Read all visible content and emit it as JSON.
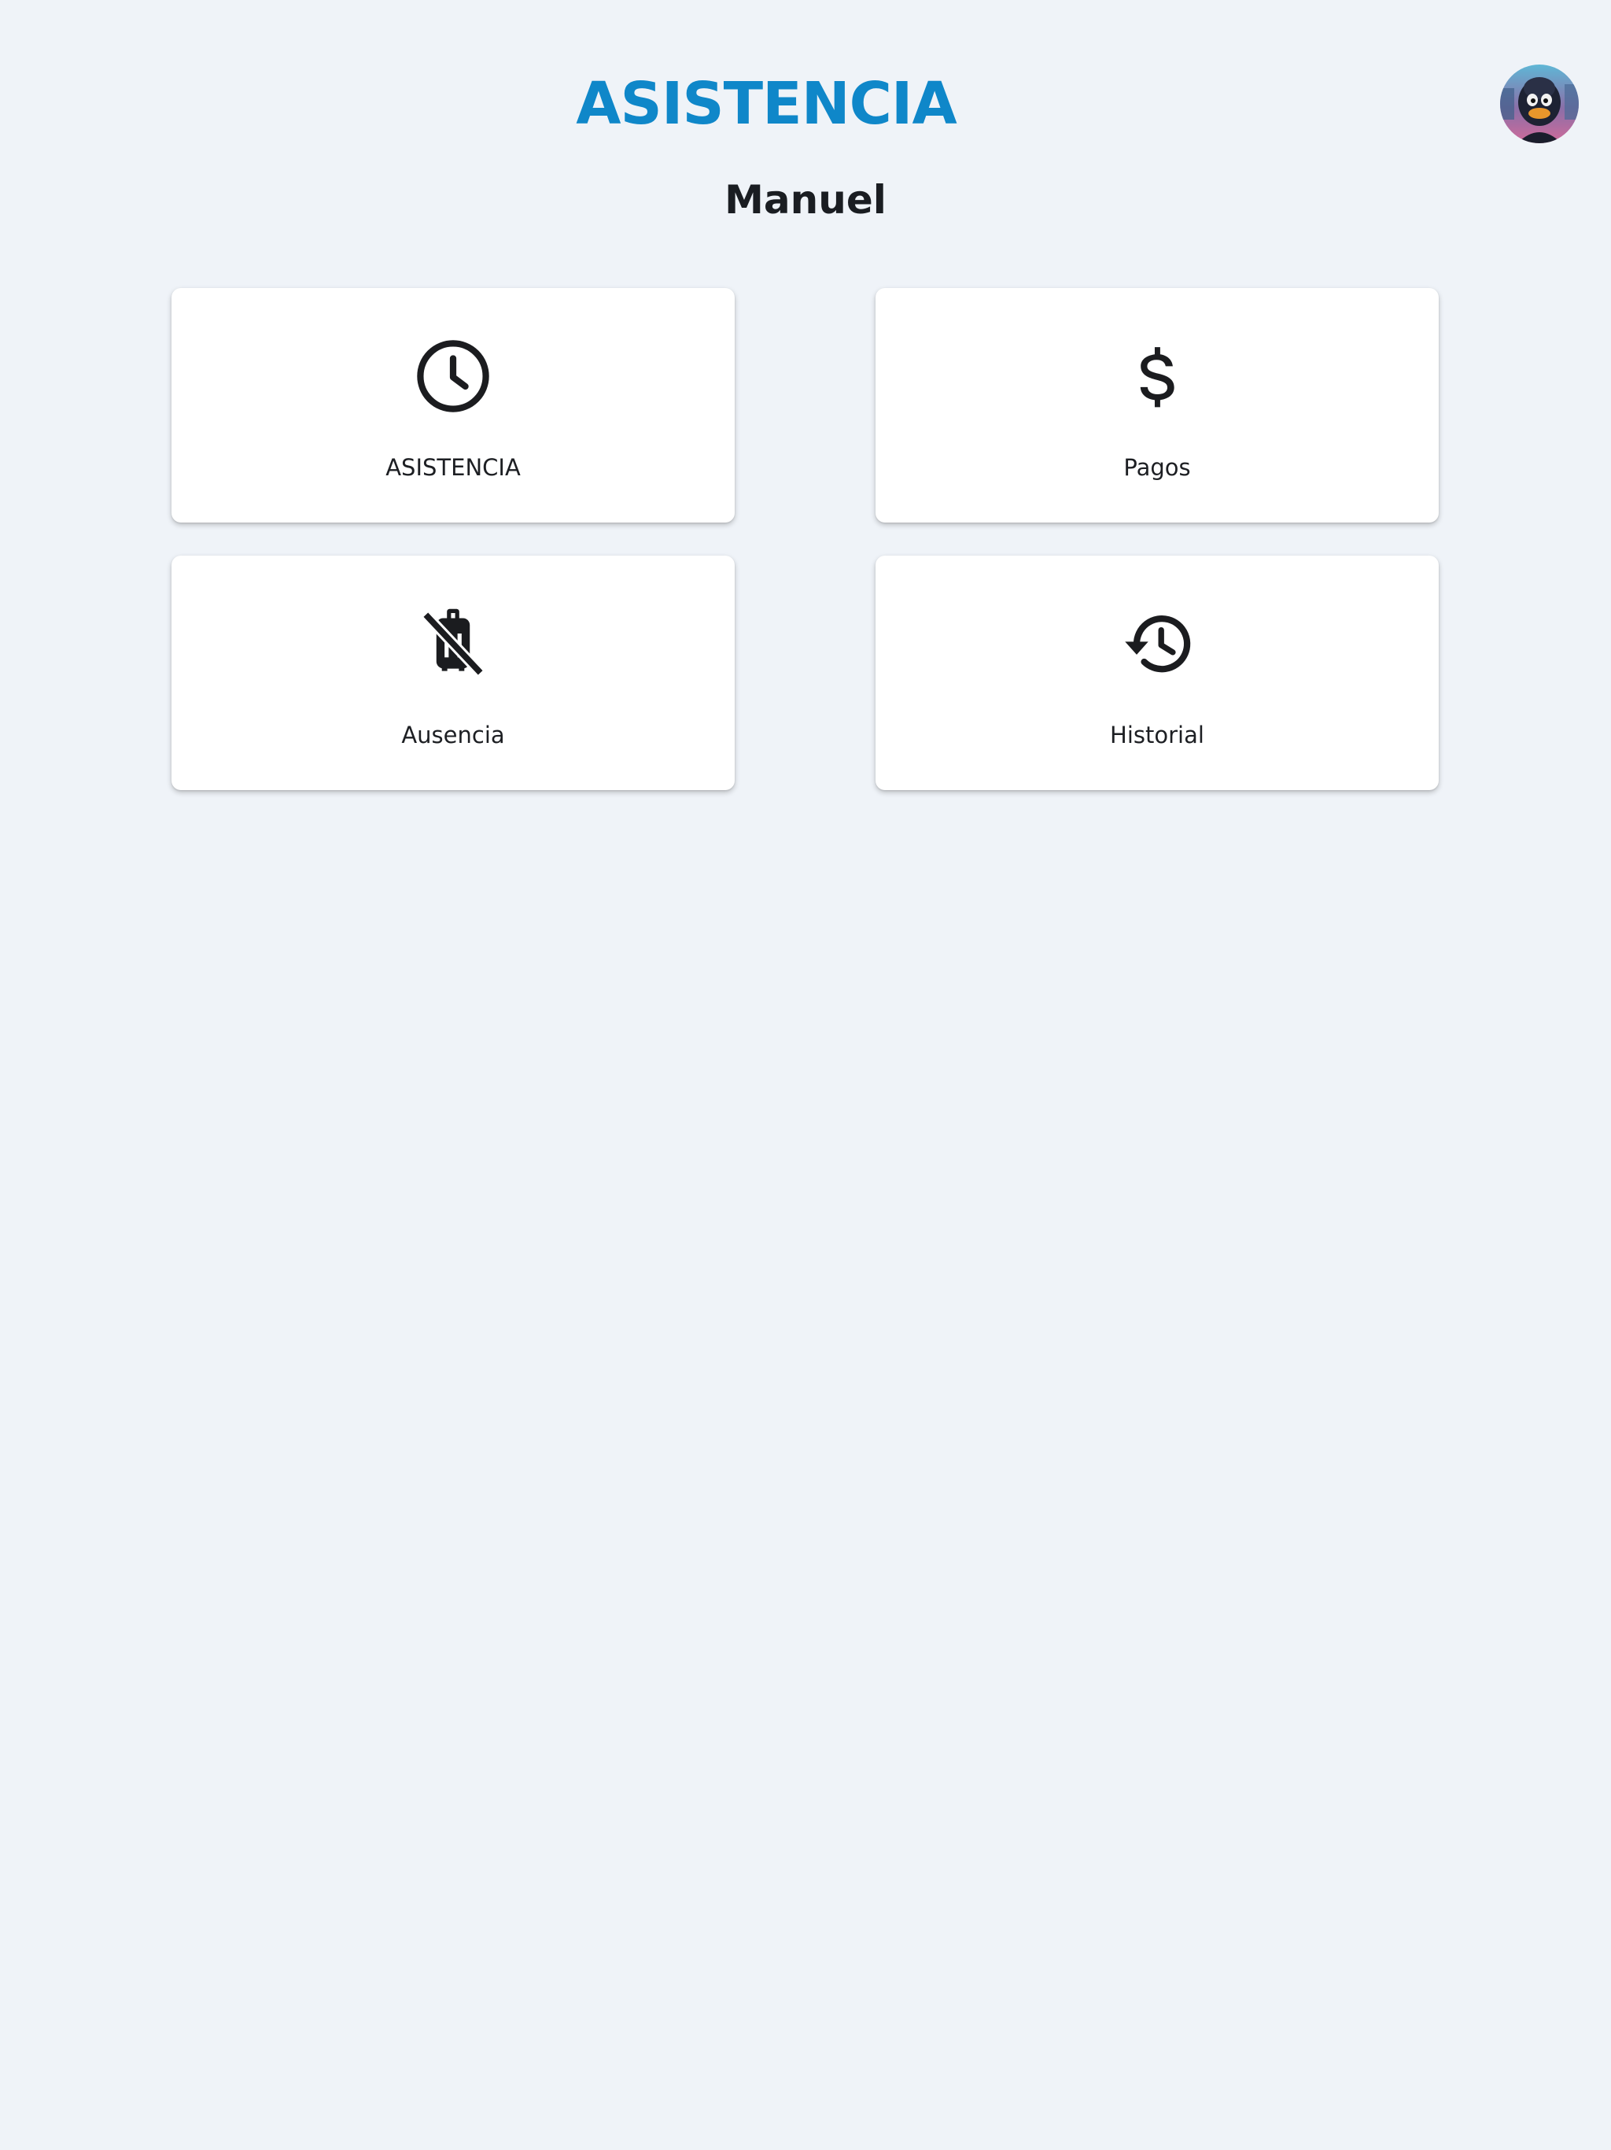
{
  "header": {
    "title": "ASISTENCIA",
    "title_color": "#0f87c9",
    "user_name": "Manuel",
    "avatar_icon": "user-avatar-image"
  },
  "menu": [
    {
      "id": "asistencia",
      "label": "ASISTENCIA",
      "icon": "clock-icon"
    },
    {
      "id": "pagos",
      "label": "Pagos",
      "icon": "dollar-icon"
    },
    {
      "id": "ausencia",
      "label": "Ausencia",
      "icon": "no-luggage-icon"
    },
    {
      "id": "historial",
      "label": "Historial",
      "icon": "history-icon"
    }
  ],
  "colors": {
    "background": "#eff3f8",
    "card": "#ffffff",
    "icon": "#1b1c1f"
  }
}
